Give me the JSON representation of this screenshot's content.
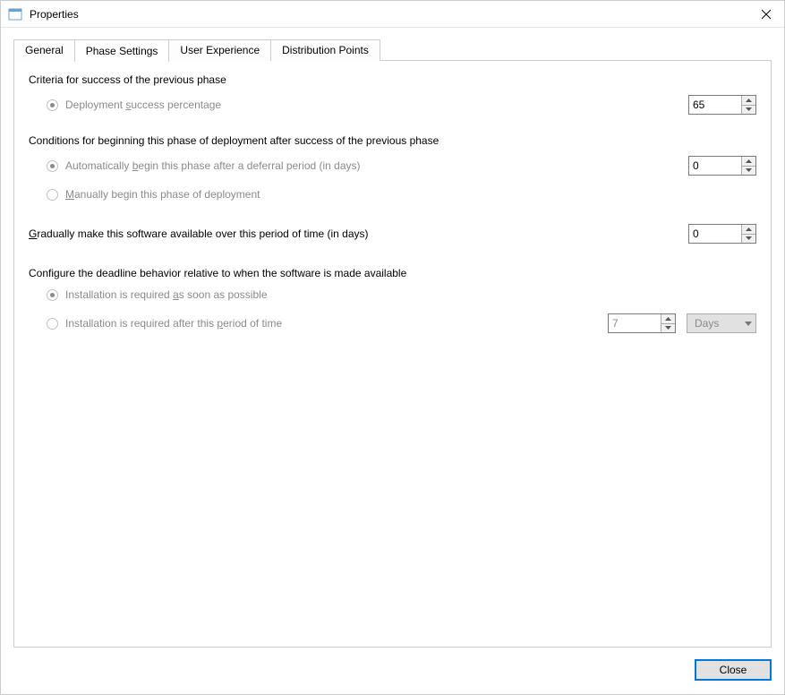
{
  "window": {
    "title": "Properties"
  },
  "tabs": {
    "general": "General",
    "phase_settings": "Phase Settings",
    "user_experience": "User Experience",
    "distribution_points": "Distribution Points",
    "active": "phase_settings"
  },
  "sections": {
    "criteria": {
      "title": "Criteria for success of the previous phase",
      "opt_percentage_pre": "Deployment ",
      "opt_percentage_m": "s",
      "opt_percentage_post": "uccess percentage",
      "percentage_value": "65"
    },
    "conditions": {
      "title": "Conditions for beginning this phase of deployment after success of the previous phase",
      "opt_auto_pre": "Automatically ",
      "opt_auto_m": "b",
      "opt_auto_post": "egin this phase after a deferral period (in days)",
      "auto_days": "0",
      "opt_manual_m": "M",
      "opt_manual_post": "anually begin this phase of deployment"
    },
    "gradual": {
      "label_m": "G",
      "label_post": "radually make this software available over this period of time (in days)",
      "days": "0"
    },
    "deadline": {
      "title": "Configure the deadline behavior relative to when the software is made available",
      "opt_asap_pre": "Installation is required ",
      "opt_asap_m": "a",
      "opt_asap_post": "s soon as possible",
      "opt_after_pre": "Installation is required after this ",
      "opt_after_m": "p",
      "opt_after_post": "eriod of time",
      "after_value": "7",
      "after_unit": "Days"
    }
  },
  "footer": {
    "close": "Close"
  }
}
